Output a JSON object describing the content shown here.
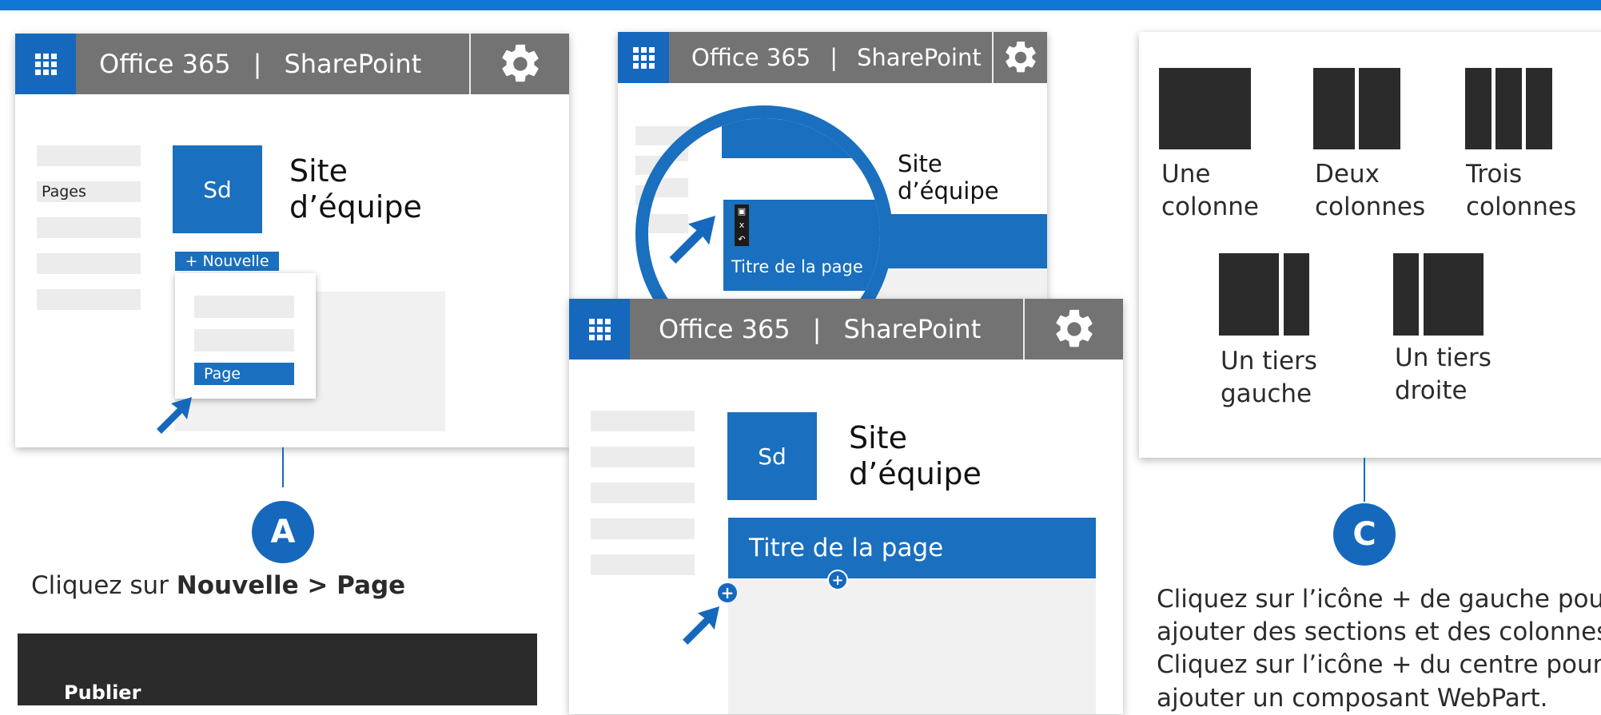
{
  "header": {
    "brand": "Office 365",
    "separator": "|",
    "app": "SharePoint"
  },
  "panel_a": {
    "site_abbr": "Sd",
    "site_title_line1": "Site",
    "site_title_line2": "d’équipe",
    "nav_pages": "Pages",
    "new_button": "+ Nouvelle",
    "menu_page": "Page"
  },
  "panel_zoom": {
    "site_title_line1": "Site",
    "site_title_line2": "d’équipe",
    "page_title": "Titre de la page",
    "toolbar_close": "x"
  },
  "panel_main": {
    "site_abbr": "Sd",
    "site_title_line1": "Site",
    "site_title_line2": "d’équipe",
    "page_title": "Titre de la page",
    "plus_left": "+",
    "plus_center": "+"
  },
  "layouts": [
    {
      "line1": "Une",
      "line2": "colonne"
    },
    {
      "line1": "Deux",
      "line2": "colonnes"
    },
    {
      "line1": "Trois",
      "line2": "colonnes"
    },
    {
      "line1": "Un tiers",
      "line2": "gauche"
    },
    {
      "line1": "Un tiers",
      "line2": "droite"
    }
  ],
  "step_a": {
    "badge": "A",
    "text_prefix": "Cliquez sur ",
    "text_bold": "Nouvelle > Page"
  },
  "step_c": {
    "badge": "C",
    "line1": "Cliquez sur l’icône + de gauche pour",
    "line2": "ajouter des sections et des colonnes.",
    "line3": "Cliquez sur l’icône + du centre pour",
    "line4": "ajouter un composant WebPart."
  },
  "publish_box": {
    "label": "Publier"
  },
  "colors": {
    "accent": "#1668bd",
    "header_gray": "#737373",
    "dark": "#2b2b2b"
  }
}
